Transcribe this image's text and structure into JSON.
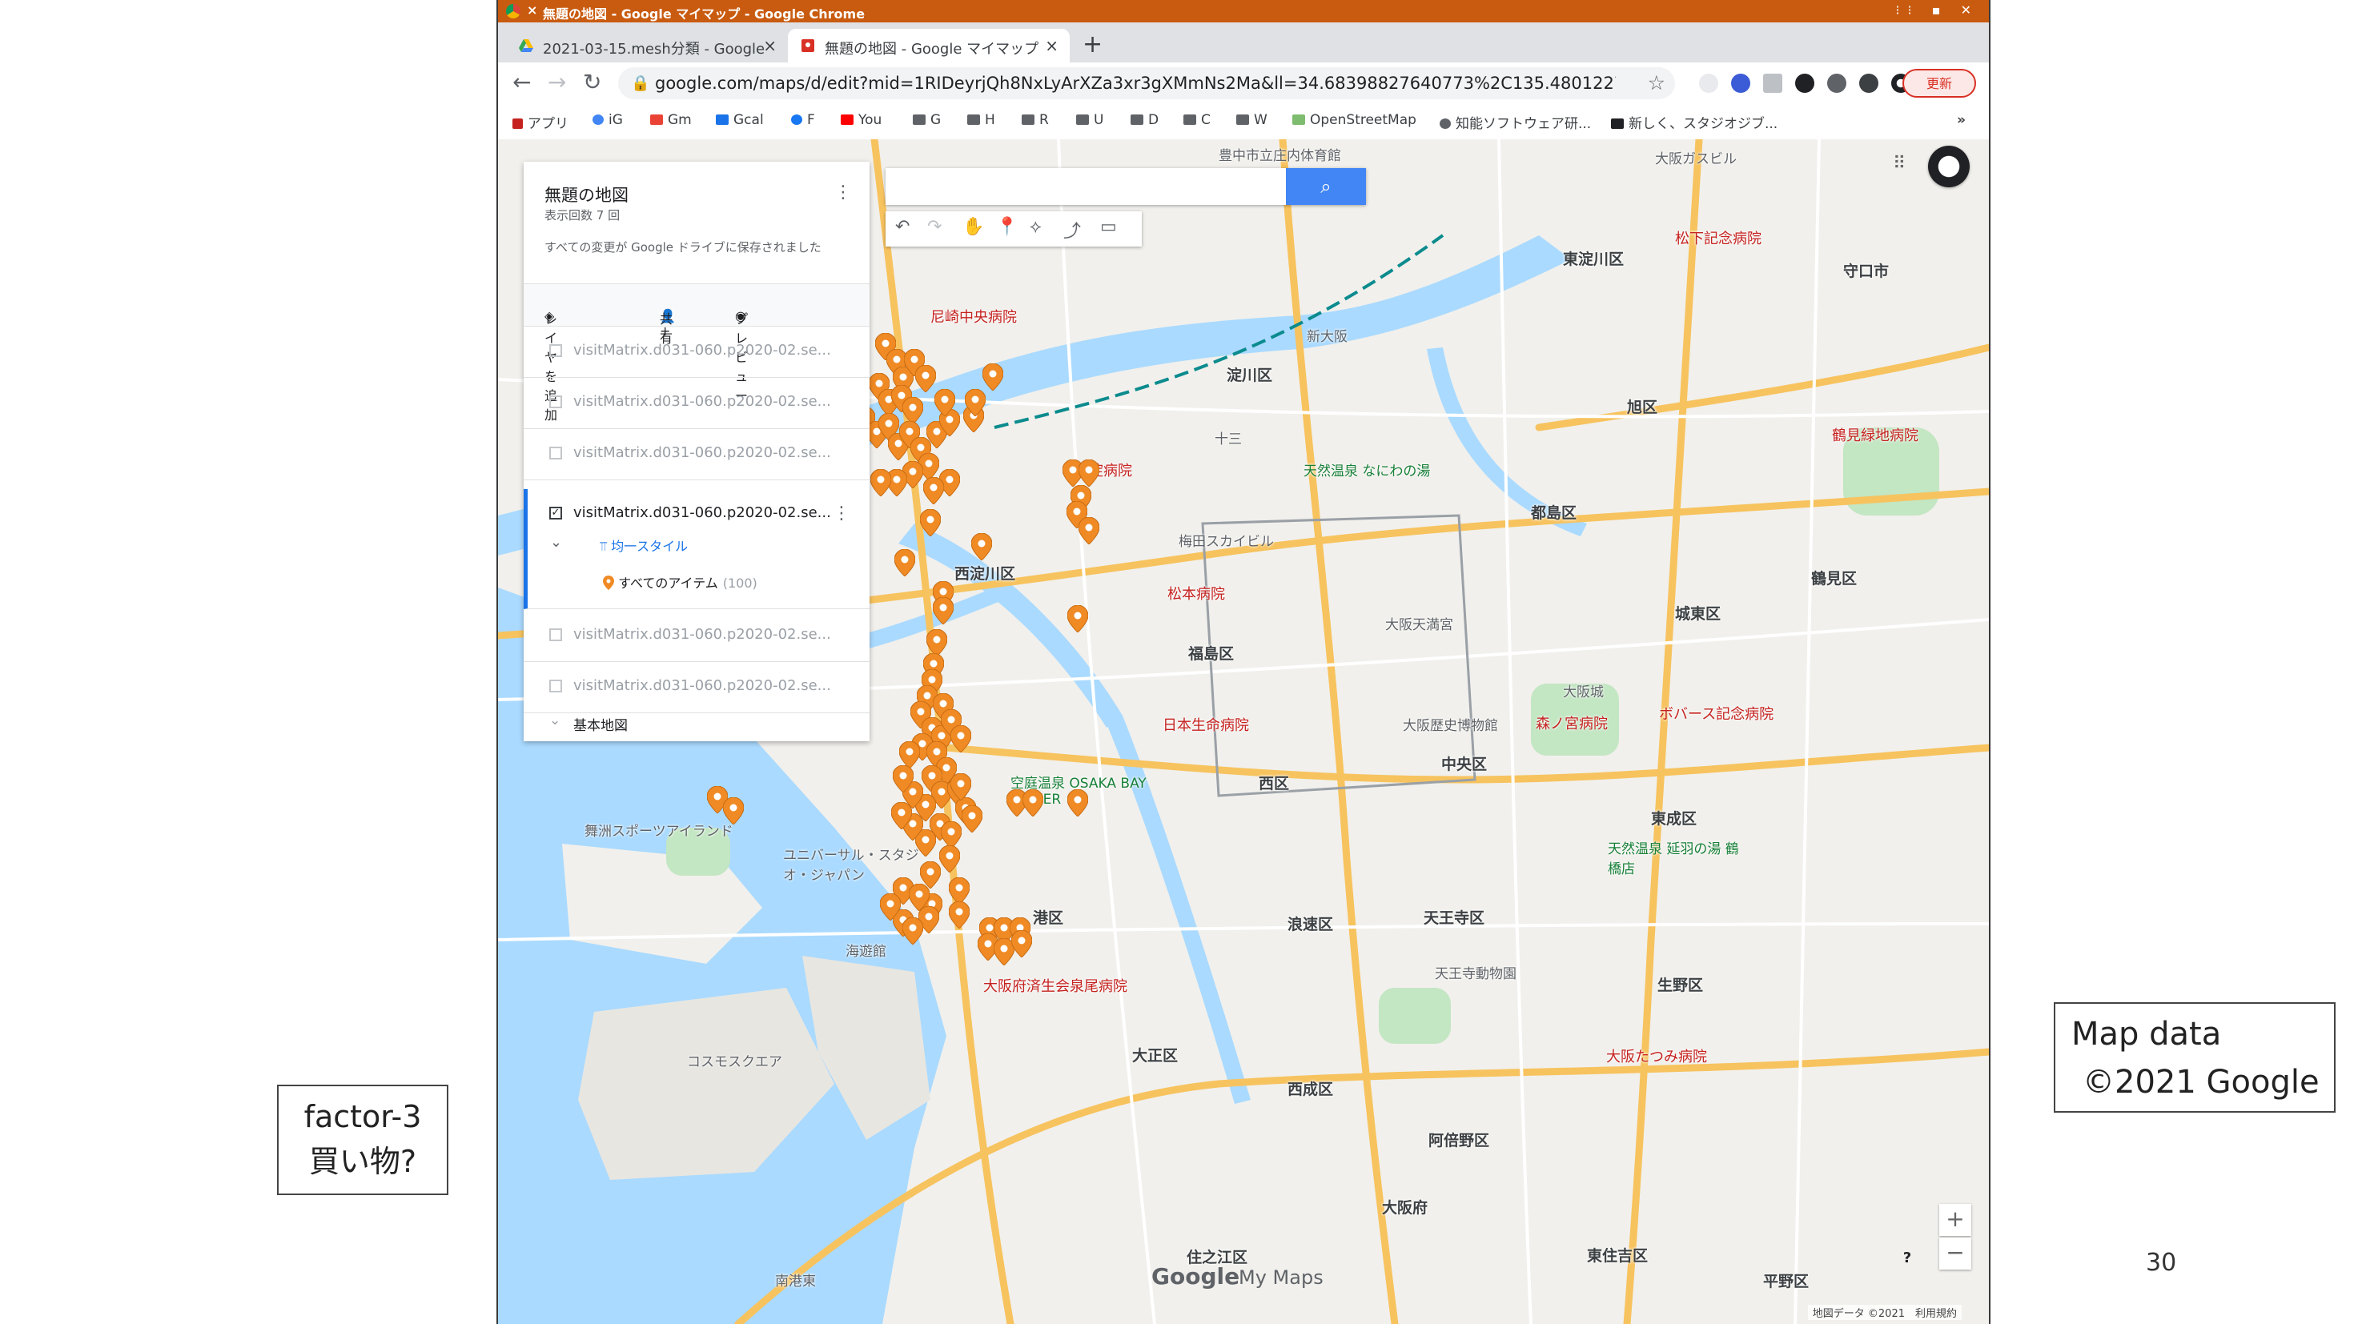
{
  "browser": {
    "window_title": "無題の地図 - Google マイマップ - Google Chrome",
    "tabs": [
      {
        "label": "2021-03-15.mesh分類 - Google",
        "active": false
      },
      {
        "label": "無題の地図 - Google マイマップ",
        "active": true
      }
    ],
    "url": "google.com/maps/d/edit?mid=1RIDeyrjQh8NxLyArXZa3xr3gXMmNs2Ma&ll=34.68398827640773%2C135.48012271664055&z...",
    "update_label": "更新",
    "bookmarks": [
      "アプリ",
      "iG",
      "Gm",
      "Gcal",
      "F",
      "You",
      "G",
      "H",
      "R",
      "U",
      "D",
      "C",
      "W",
      "OpenStreetMap",
      "知能ソフトウェア研...",
      "新しく、スタジオジブ..."
    ],
    "more_bookmarks": "»"
  },
  "panel": {
    "title": "無題の地図",
    "views": "表示回数 7 回",
    "saved_msg": "すべての変更が Google ドライブに保存されました",
    "actions": {
      "add_layer": "レイヤを追加",
      "share": "共有",
      "preview": "プレビュー"
    },
    "layers": [
      "visitMatrix.d031-060.p2020-02.se...",
      "visitMatrix.d031-060.p2020-02.se...",
      "visitMatrix.d031-060.p2020-02.se...",
      "visitMatrix.d031-060.p2020-02.se...",
      "visitMatrix.d031-060.p2020-02.se...",
      "visitMatrix.d031-060.p2020-02.se..."
    ],
    "active_layer_index": 3,
    "style_label": "均一スタイル",
    "all_items_label": "すべてのアイテム",
    "all_items_count": "(100)",
    "base_map_label": "基本地図"
  },
  "map": {
    "places": [
      {
        "text": "豊中市立庄内体育館",
        "cls": ""
      },
      {
        "text": "大阪ガスビル",
        "cls": ""
      },
      {
        "text": "守口市",
        "cls": "big"
      },
      {
        "text": "松下記念病院",
        "cls": "red"
      },
      {
        "text": "東淀川区",
        "cls": "big"
      },
      {
        "text": "尼崎中央病院",
        "cls": "red"
      },
      {
        "text": "淀川区",
        "cls": "big"
      },
      {
        "text": "十三",
        "cls": ""
      },
      {
        "text": "新大阪",
        "cls": ""
      },
      {
        "text": "旭区",
        "cls": "big"
      },
      {
        "text": "鶴見緑地病院",
        "cls": "red"
      },
      {
        "text": "天然温泉 なにわの湯",
        "cls": "green"
      },
      {
        "text": "西淀病院",
        "cls": "red"
      },
      {
        "text": "都島区",
        "cls": "big"
      },
      {
        "text": "梅田スカイビル",
        "cls": ""
      },
      {
        "text": "西淀川区",
        "cls": "big"
      },
      {
        "text": "松本病院",
        "cls": "red"
      },
      {
        "text": "鶴見区",
        "cls": "big"
      },
      {
        "text": "城東区",
        "cls": "big"
      },
      {
        "text": "福島区",
        "cls": "big"
      },
      {
        "text": "大阪天満宮",
        "cls": ""
      },
      {
        "text": "大阪城",
        "cls": ""
      },
      {
        "text": "ボバース記念病院",
        "cls": "red"
      },
      {
        "text": "日本生命病院",
        "cls": "red"
      },
      {
        "text": "大阪歴史博物館",
        "cls": ""
      },
      {
        "text": "森ノ宮病院",
        "cls": "red"
      },
      {
        "text": "西区",
        "cls": "big"
      },
      {
        "text": "中央区",
        "cls": "big"
      },
      {
        "text": "東成区",
        "cls": "big"
      },
      {
        "text": "空庭温泉 OSAKA BAY TOWER",
        "cls": "green"
      },
      {
        "text": "舞洲スポーツアイランド",
        "cls": ""
      },
      {
        "text": "ユニバーサル・スタジオ・ジャパン",
        "cls": ""
      },
      {
        "text": "港区",
        "cls": "big"
      },
      {
        "text": "海遊館",
        "cls": ""
      },
      {
        "text": "天然温泉 延羽の湯 鶴橋店",
        "cls": "green"
      },
      {
        "text": "天王寺区",
        "cls": "big"
      },
      {
        "text": "浪速区",
        "cls": "big"
      },
      {
        "text": "生野区",
        "cls": "big"
      },
      {
        "text": "大阪府済生会泉尾病院",
        "cls": "red"
      },
      {
        "text": "天王寺動物園",
        "cls": ""
      },
      {
        "text": "大阪たつみ病院",
        "cls": "red"
      },
      {
        "text": "大正区",
        "cls": "big"
      },
      {
        "text": "西成区",
        "cls": "big"
      },
      {
        "text": "阿倍野区",
        "cls": "big"
      },
      {
        "text": "コスモスクエア",
        "cls": ""
      },
      {
        "text": "大阪府",
        "cls": "big"
      },
      {
        "text": "住之江区",
        "cls": "big"
      },
      {
        "text": "東住吉区",
        "cls": "big"
      },
      {
        "text": "平野区",
        "cls": "big"
      },
      {
        "text": "南港東",
        "cls": ""
      }
    ],
    "tools": [
      "↶",
      "↷",
      "✋",
      "📍",
      "⟡",
      "⤴",
      "▭"
    ],
    "google_logo": "Google",
    "mymaps_logo": "My Maps",
    "footer": "地図データ ©2021　利用規約",
    "zoom_in": "+",
    "zoom_out": "−",
    "help": "?"
  },
  "slide": {
    "factor_line1": "factor-3",
    "factor_line2": "買い物?",
    "credit_line1": "Map data",
    "credit_line2": "©2021 Google",
    "page_number": "30"
  },
  "colors": {
    "pin": "#f08a24",
    "accent": "#1a73e8",
    "titlebar": "#c95b10"
  }
}
